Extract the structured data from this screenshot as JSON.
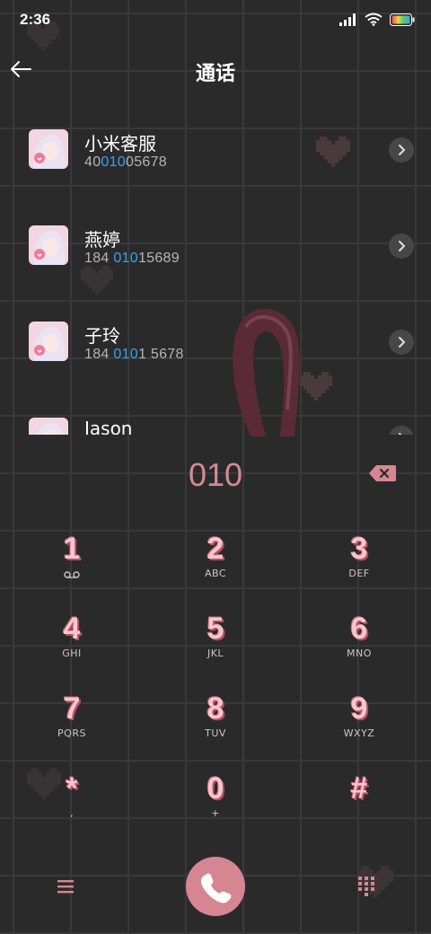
{
  "status_bar": {
    "time": "2:36"
  },
  "header": {
    "title": "通话"
  },
  "contacts": [
    {
      "name": "小米客服",
      "number_pre": "40",
      "number_hl": "010",
      "number_post": "05678"
    },
    {
      "name": "燕婷",
      "number_pre": "184 ",
      "number_hl": "010",
      "number_post": "15689"
    },
    {
      "name": "子玲",
      "number_pre": "184 ",
      "number_hl": "010",
      "number_post": "1 5678"
    },
    {
      "name": "Jason",
      "number_pre": "",
      "number_hl": "",
      "number_post": ""
    }
  ],
  "dialer": {
    "input": "010"
  },
  "keypad": [
    {
      "digit": "1",
      "letters": ""
    },
    {
      "digit": "2",
      "letters": "ABC"
    },
    {
      "digit": "3",
      "letters": "DEF"
    },
    {
      "digit": "4",
      "letters": "GHI"
    },
    {
      "digit": "5",
      "letters": "JKL"
    },
    {
      "digit": "6",
      "letters": "MNO"
    },
    {
      "digit": "7",
      "letters": "PQRS"
    },
    {
      "digit": "8",
      "letters": "TUV"
    },
    {
      "digit": "9",
      "letters": "WXYZ"
    },
    {
      "digit": "*",
      "letters": ","
    },
    {
      "digit": "0",
      "letters": "+"
    },
    {
      "digit": "#",
      "letters": ""
    }
  ],
  "icons": {
    "back": "arrow-left-icon",
    "arrow": "chevron-right-icon",
    "backspace": "backspace-icon",
    "voicemail": "voicemail-icon",
    "menu": "menu-icon",
    "call": "phone-icon",
    "dialpad": "dialpad-icon"
  },
  "colors": {
    "background": "#2b2a2b",
    "accent": "#d68693",
    "highlight": "#2ea5f4",
    "digit": "#f7c6cc"
  }
}
